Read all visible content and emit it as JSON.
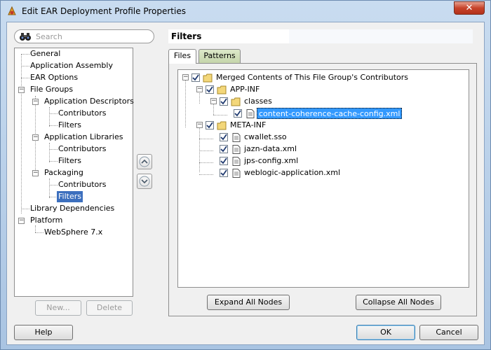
{
  "window": {
    "title": "Edit EAR Deployment Profile Properties",
    "close_label": "✕"
  },
  "search": {
    "placeholder": "Search"
  },
  "nav_tree": {
    "items": [
      {
        "label": "General"
      },
      {
        "label": "Application Assembly"
      },
      {
        "label": "EAR Options"
      },
      {
        "label": "File Groups"
      },
      {
        "label": "Application Descriptors"
      },
      {
        "label": "Contributors"
      },
      {
        "label": "Filters"
      },
      {
        "label": "Application Libraries"
      },
      {
        "label": "Contributors"
      },
      {
        "label": "Filters"
      },
      {
        "label": "Packaging"
      },
      {
        "label": "Contributors"
      },
      {
        "label": "Filters"
      },
      {
        "label": "Library Dependencies"
      },
      {
        "label": "Platform"
      },
      {
        "label": "WebSphere 7.x"
      }
    ],
    "selected": "Filters"
  },
  "left_buttons": {
    "new_label": "New...",
    "delete_label": "Delete"
  },
  "page": {
    "title": "Filters",
    "tabs": [
      {
        "label": "Files",
        "active": true
      },
      {
        "label": "Patterns",
        "active": false
      }
    ]
  },
  "file_tree": {
    "items": [
      {
        "label": "Merged Contents of This File Group's Contributors",
        "type": "folder",
        "checked": true
      },
      {
        "label": "APP-INF",
        "type": "folder",
        "checked": true
      },
      {
        "label": "classes",
        "type": "folder",
        "checked": true
      },
      {
        "label": "content-coherence-cache-config.xml",
        "type": "file",
        "checked": true
      },
      {
        "label": "META-INF",
        "type": "folder",
        "checked": true
      },
      {
        "label": "cwallet.sso",
        "type": "file",
        "checked": true
      },
      {
        "label": "jazn-data.xml",
        "type": "file",
        "checked": true
      },
      {
        "label": "jps-config.xml",
        "type": "file",
        "checked": true
      },
      {
        "label": "weblogic-application.xml",
        "type": "file",
        "checked": true
      }
    ]
  },
  "tree_buttons": {
    "expand_label": "Expand All Nodes",
    "collapse_label": "Collapse All Nodes"
  },
  "footer": {
    "help_label": "Help",
    "ok_label": "OK",
    "cancel_label": "Cancel"
  },
  "colors": {
    "selection": "#3c6fbe",
    "highlight": "#3399ff",
    "tab_inactive": "#c5d6ab"
  }
}
